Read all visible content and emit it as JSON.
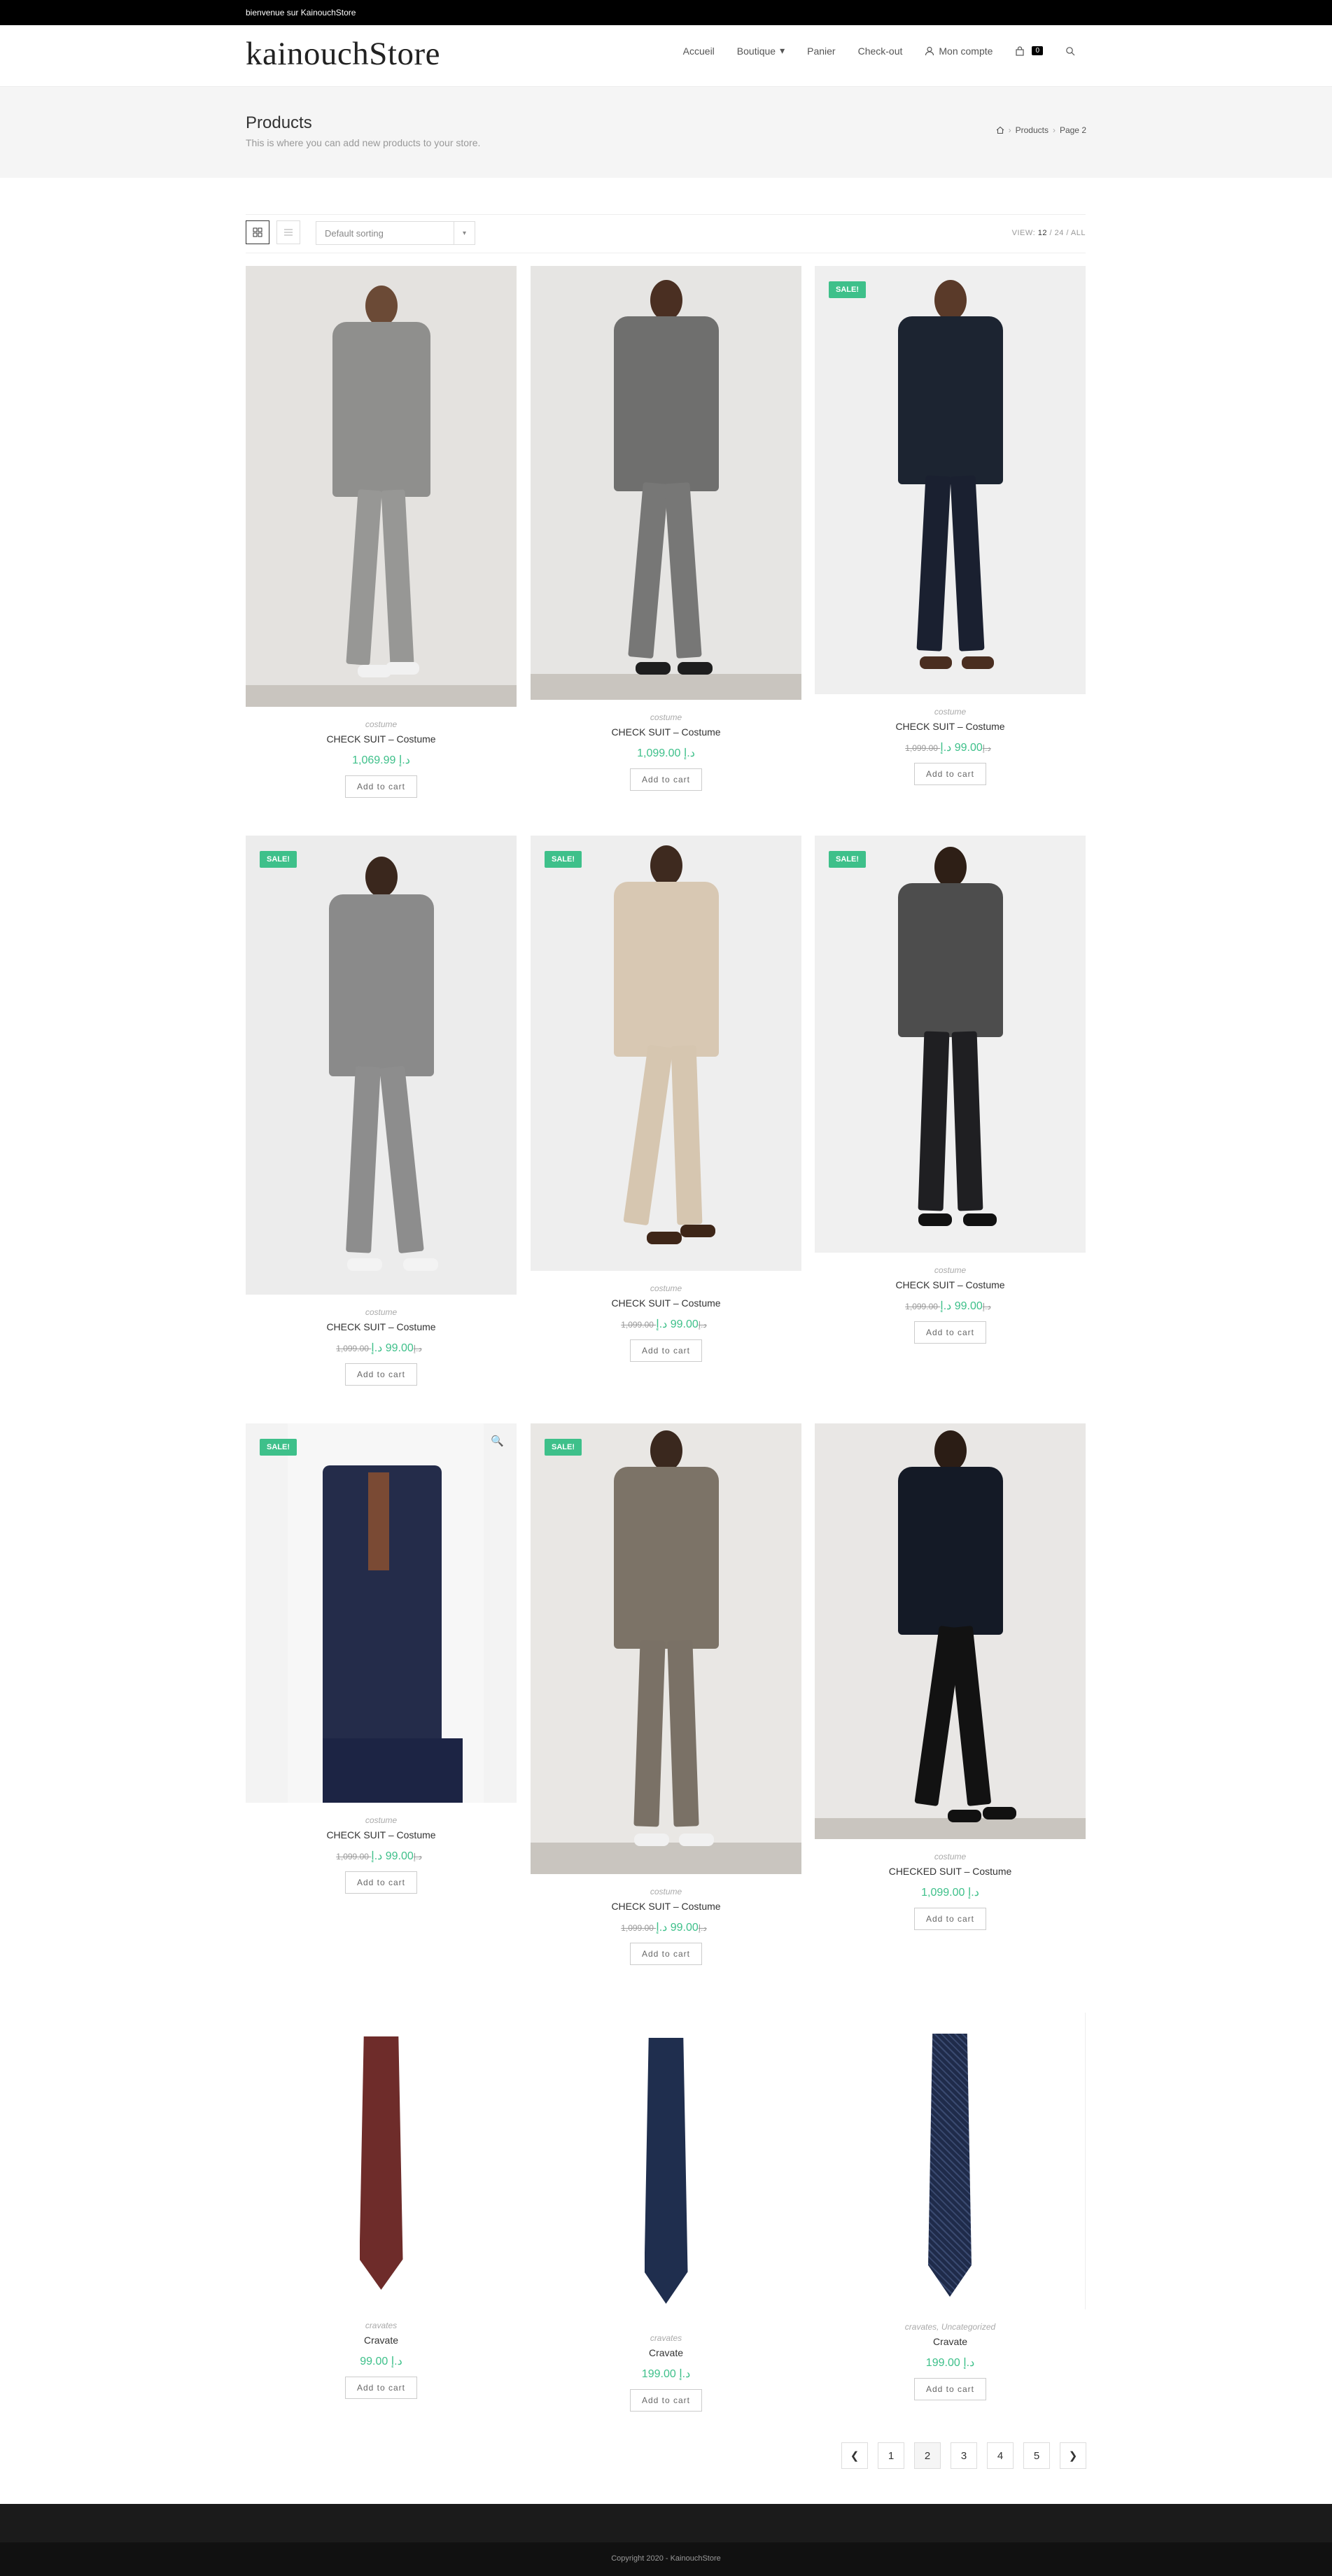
{
  "topbar": {
    "text": "bienvenue sur KainouchStore"
  },
  "header": {
    "logo": "kainouchStore",
    "nav": [
      {
        "label": "Accueil"
      },
      {
        "label": "Boutique"
      },
      {
        "label": "Panier"
      },
      {
        "label": "Check-out"
      },
      {
        "label": "Mon compte"
      }
    ],
    "cart_count": "0"
  },
  "page_header": {
    "title": "Products",
    "subtitle": "This is where you can add new products to your store.",
    "breadcrumb": [
      "Products",
      "Page 2"
    ]
  },
  "toolbar": {
    "sort": "Default sorting",
    "view_label": "VIEW:",
    "view_current": "12",
    "view_options": "/ 24 / ALL"
  },
  "products": [
    {
      "category": "costume",
      "title": "CHECK SUIT – Costume",
      "old_price": "",
      "price": "1,069.99 د.إ",
      "sale": "",
      "button": "Add to cart"
    },
    {
      "category": "costume",
      "title": "CHECK SUIT – Costume",
      "old_price": "",
      "price": "1,099.00 د.إ",
      "sale": "",
      "button": "Add to cart"
    },
    {
      "category": "costume",
      "title": "CHECK SUIT – Costume",
      "old_price": "1,099.00 د.إ",
      "price": "99.00 د.إ",
      "sale": "SALE!",
      "button": "Add to cart"
    },
    {
      "category": "costume",
      "title": "CHECK SUIT – Costume",
      "old_price": "1,099.00 د.إ",
      "price": "99.00 د.إ",
      "sale": "SALE!",
      "button": "Add to cart"
    },
    {
      "category": "costume",
      "title": "CHECK SUIT – Costume",
      "old_price": "1,099.00 د.إ",
      "price": "99.00 د.إ",
      "sale": "SALE!",
      "button": "Add to cart"
    },
    {
      "category": "costume",
      "title": "CHECK SUIT – Costume",
      "old_price": "1,099.00 د.إ",
      "price": "99.00 د.إ",
      "sale": "SALE!",
      "button": "Add to cart"
    },
    {
      "category": "costume",
      "title": "CHECK SUIT – Costume",
      "old_price": "1,099.00 د.إ",
      "price": "99.00 د.إ",
      "sale": "SALE!",
      "button": "Add to cart"
    },
    {
      "category": "costume",
      "title": "CHECK SUIT – Costume",
      "old_price": "1,099.00 د.إ",
      "price": "99.00 د.إ",
      "sale": "SALE!",
      "button": "Add to cart"
    },
    {
      "category": "costume",
      "title": "CHECKED SUIT – Costume",
      "old_price": "",
      "price": "1,099.00 د.إ",
      "sale": "",
      "button": "Add to cart"
    },
    {
      "category": "cravates",
      "title": "Cravate",
      "old_price": "",
      "price": "99.00 د.إ",
      "sale": "",
      "button": "Add to cart"
    },
    {
      "category": "cravates",
      "title": "Cravate",
      "old_price": "",
      "price": "199.00 د.إ",
      "sale": "",
      "button": "Add to cart"
    },
    {
      "category": "cravates, Uncategorized",
      "title": "Cravate",
      "old_price": "",
      "price": "199.00 د.إ",
      "sale": "",
      "button": "Add to cart"
    }
  ],
  "pagination": {
    "pages": [
      "1",
      "2",
      "3",
      "4",
      "5"
    ],
    "current": "2"
  },
  "footer": {
    "copyright": "Copyright 2020 - KainouchStore"
  }
}
